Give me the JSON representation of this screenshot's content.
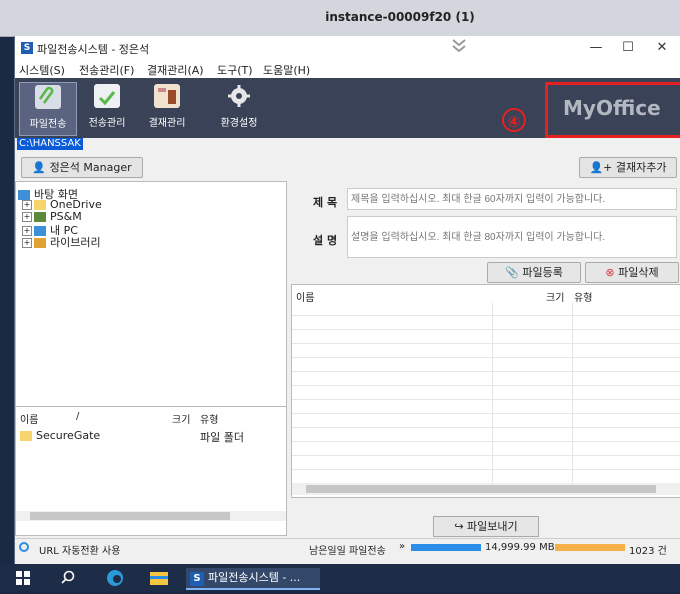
{
  "remote": {
    "title": "instance-00009f20 (1)"
  },
  "window": {
    "icon_letter": "S",
    "title": "파일전송시스템 - 정은석",
    "minimize": "—",
    "maximize": "☐",
    "close": "✕"
  },
  "menu": [
    {
      "label": "시스템(S)"
    },
    {
      "label": "전송관리(F)"
    },
    {
      "label": "결재관리(A)"
    },
    {
      "label": "도구(T)"
    },
    {
      "label": "도움말(H)"
    }
  ],
  "toolbar": {
    "file": "파일전송",
    "transfer": "전송관리",
    "approval": "결재관리",
    "settings": "환경설정"
  },
  "brand": {
    "name": "MyOffice",
    "annotation": "④",
    "annotation_color": "#e62020"
  },
  "path": "C:\\HANSSAK",
  "user_button": "정은석 Manager",
  "add_approver_button": "결재자추가",
  "tree": {
    "root": "바탕 화면",
    "items": [
      {
        "label": "OneDrive"
      },
      {
        "label": "PS&M"
      },
      {
        "label": "내 PC"
      },
      {
        "label": "라이브러리"
      }
    ]
  },
  "left_list": {
    "headers": {
      "name": "이름",
      "sort": "/",
      "size": "크기",
      "type": "유형"
    },
    "rows": [
      {
        "name": "SecureGate",
        "type": "파일 폴더"
      }
    ]
  },
  "form": {
    "subject_label": "제 목",
    "subject_placeholder": "제목을 입력하십시오. 최대 한글 60자까지 입력이 가능합니다.",
    "desc_label": "설 명",
    "desc_placeholder": "설명을 입력하십시오. 최대 한글 80자까지 입력이 가능합니다.",
    "register_button": "파일등록",
    "delete_button": "파일삭제"
  },
  "file_table": {
    "headers": {
      "name": "이름",
      "size": "크기",
      "type": "유형"
    }
  },
  "send_button": "파일보내기",
  "status": {
    "url_label": "URL 자동전환 사용",
    "remaining_label": "남은일일 파일전송",
    "arrows": "»",
    "size_remaining": "14,999.99 MB",
    "count_remaining": "1023 건",
    "accent": "#2a8ee6",
    "count_bar_color": "#f5b04a"
  },
  "taskbar": {
    "app_label": "파일전송시스템 - ..."
  }
}
